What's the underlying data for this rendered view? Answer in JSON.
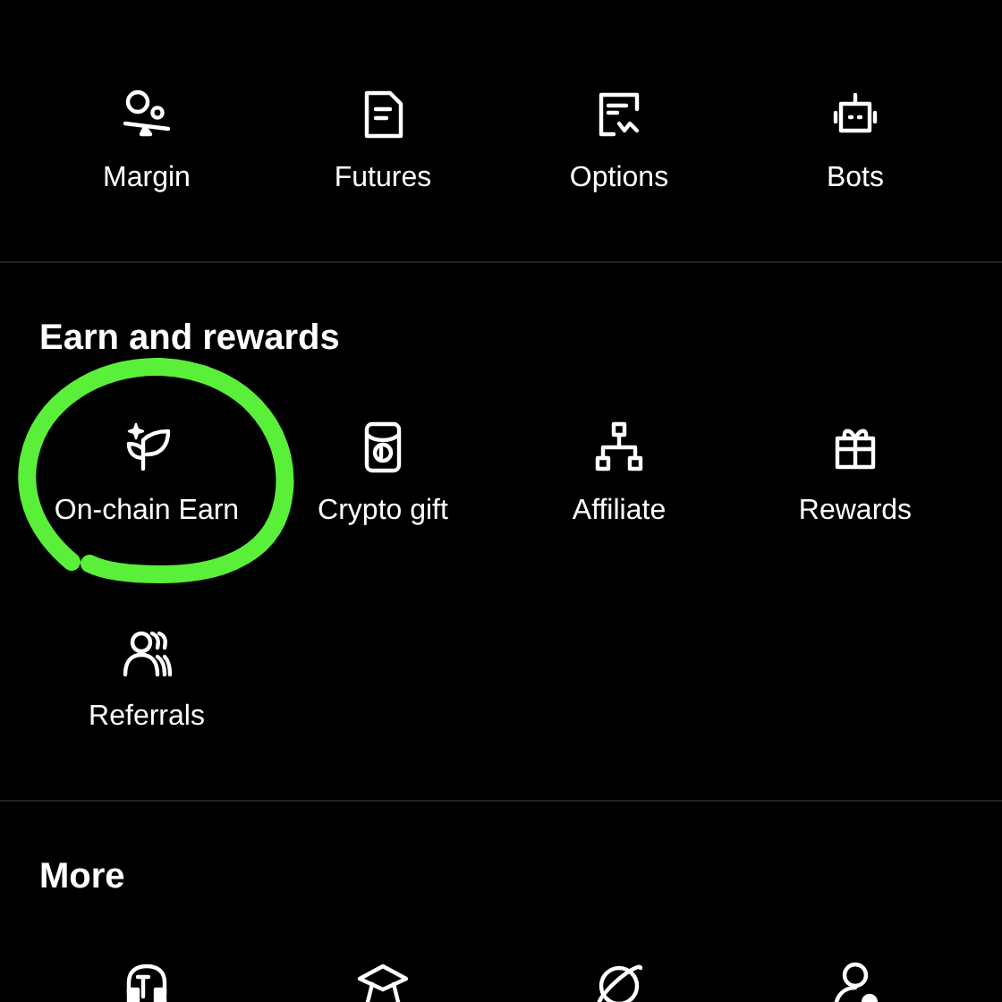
{
  "sections": [
    {
      "items": [
        {
          "label": "Margin",
          "circled": false
        },
        {
          "label": "Futures",
          "circled": false
        },
        {
          "label": "Options",
          "circled": false
        },
        {
          "label": "Bots",
          "circled": false
        }
      ]
    },
    {
      "title": "Earn and rewards",
      "items": [
        {
          "label": "On-chain Earn",
          "circled": true
        },
        {
          "label": "Crypto gift",
          "circled": false
        },
        {
          "label": "Affiliate",
          "circled": false
        },
        {
          "label": "Rewards",
          "circled": false
        },
        {
          "label": "Referrals",
          "circled": false
        }
      ]
    },
    {
      "title": "More",
      "items": [
        {
          "circled": false
        },
        {
          "circled": false
        },
        {
          "circled": false
        },
        {
          "circled": false
        }
      ]
    }
  ]
}
